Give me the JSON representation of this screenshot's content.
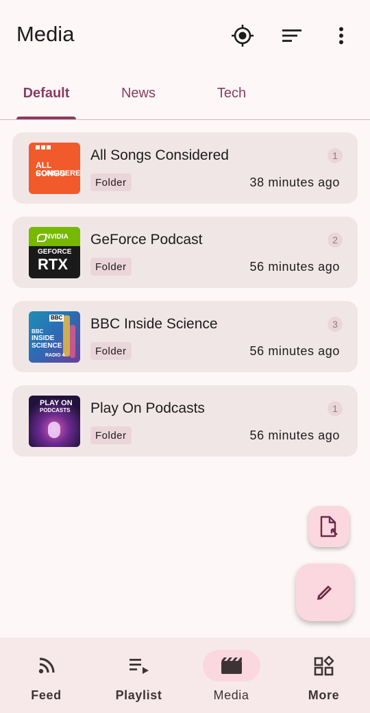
{
  "app_bar": {
    "title": "Media",
    "icons": [
      "locate-icon",
      "sort-icon",
      "more-vert-icon"
    ]
  },
  "tabs": [
    {
      "label": "Default",
      "active": true
    },
    {
      "label": "News",
      "active": false
    },
    {
      "label": "Tech",
      "active": false
    }
  ],
  "feeds": [
    {
      "title": "All Songs Considered",
      "count": "1",
      "tag": "Folder",
      "updated": "38 minutes ago",
      "art_text": [
        "ALL SONGS",
        "CONSIDERED"
      ],
      "art_color": "#f15a2b"
    },
    {
      "title": "GeForce Podcast",
      "count": "2",
      "tag": "Folder",
      "updated": "56 minutes ago",
      "art_text": [
        "NVIDIA",
        "GEFORCE",
        "RTX"
      ],
      "art_color": "#76b900"
    },
    {
      "title": "BBC Inside Science",
      "count": "3",
      "tag": "Folder",
      "updated": "56 minutes ago",
      "art_text": [
        "BBC",
        "BBC",
        "INSIDE",
        "SCIENCE",
        "RADIO 4"
      ],
      "art_color": "#2f6fb0"
    },
    {
      "title": "Play On Podcasts",
      "count": "1",
      "tag": "Folder",
      "updated": "56 minutes ago",
      "art_text": [
        "PLAY ON",
        "PODCASTS"
      ],
      "art_color": "#3a1d5c"
    }
  ],
  "fabs": {
    "small_icon": "file-import-icon",
    "large_icon": "edit-pencil-icon"
  },
  "bottom_nav": [
    {
      "label": "Feed",
      "icon": "rss-feed-icon",
      "active": false
    },
    {
      "label": "Playlist",
      "icon": "playlist-play-icon",
      "active": false
    },
    {
      "label": "Media",
      "icon": "movie-icon",
      "active": true
    },
    {
      "label": "More",
      "icon": "widgets-icon",
      "active": false
    }
  ],
  "colors": {
    "accent": "#8c3a5f",
    "background": "#fdf7f7",
    "card": "#f1e6e6",
    "fab": "#fbd7df",
    "nav": "#f7e9ea"
  }
}
